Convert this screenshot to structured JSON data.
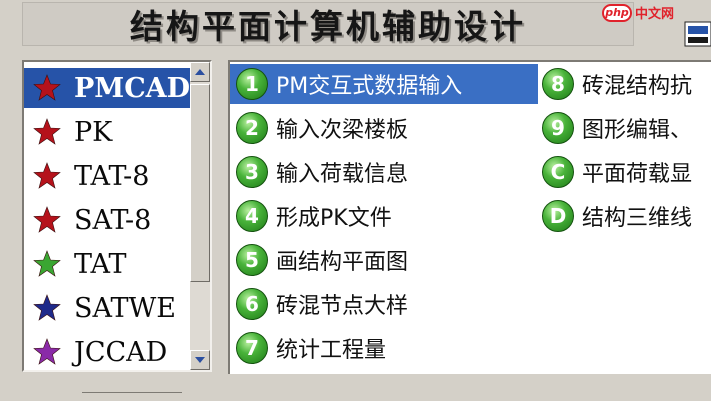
{
  "window": {
    "title": "结构平面计算机辅助设计"
  },
  "programs": [
    {
      "label": "PMCAD",
      "star_color": "#b5121b",
      "selected": true
    },
    {
      "label": "PK",
      "star_color": "#b5121b",
      "selected": false
    },
    {
      "label": "TAT-8",
      "star_color": "#b5121b",
      "selected": false
    },
    {
      "label": "SAT-8",
      "star_color": "#b5121b",
      "selected": false
    },
    {
      "label": "TAT",
      "star_color": "#3aa632",
      "selected": false
    },
    {
      "label": "SATWE",
      "star_color": "#1f2a8a",
      "selected": false
    },
    {
      "label": "JCCAD",
      "star_color": "#8a2aa8",
      "selected": false
    }
  ],
  "functions": {
    "left_column": [
      {
        "badge": "1",
        "label": "PM交互式数据输入",
        "selected": true
      },
      {
        "badge": "2",
        "label": "输入次梁楼板",
        "selected": false
      },
      {
        "badge": "3",
        "label": "输入荷载信息",
        "selected": false
      },
      {
        "badge": "4",
        "label": "形成PK文件",
        "selected": false
      },
      {
        "badge": "5",
        "label": "画结构平面图",
        "selected": false
      },
      {
        "badge": "6",
        "label": "砖混节点大样",
        "selected": false
      },
      {
        "badge": "7",
        "label": "统计工程量",
        "selected": false
      }
    ],
    "right_column": [
      {
        "badge": "8",
        "label": "砖混结构抗",
        "selected": false
      },
      {
        "badge": "9",
        "label": "图形编辑、",
        "selected": false
      },
      {
        "badge": "C",
        "label": "平面荷载显",
        "selected": false
      },
      {
        "badge": "D",
        "label": "结构三维线",
        "selected": false
      }
    ]
  },
  "watermark": {
    "badge": "php",
    "text": "中文网"
  },
  "colors": {
    "window_bg": "#d4d0c8",
    "selection_blue": "#2653a8",
    "badge_green": "#2f9a26"
  }
}
